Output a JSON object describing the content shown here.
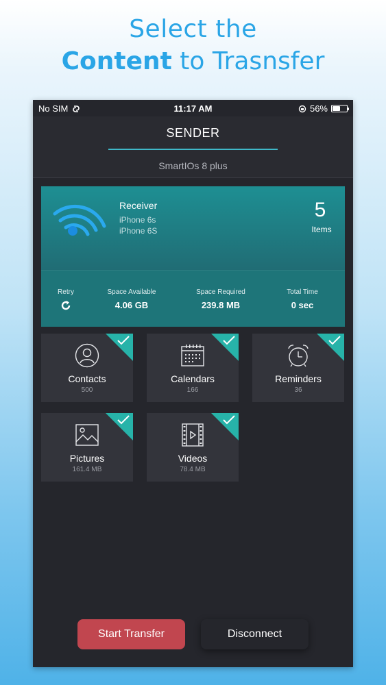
{
  "headline": {
    "line1": "Select the",
    "line2_bold": "Content",
    "line2_rest": " to Trasnsfer"
  },
  "status_bar": {
    "carrier": "No SIM",
    "time": "11:17 AM",
    "battery": "56%",
    "battery_level": 0.56
  },
  "nav": {
    "title": "SENDER",
    "device": "SmartIOs 8 plus"
  },
  "receiver": {
    "label": "Receiver",
    "line1": "iPhone 6s",
    "line2": "iPhone 6S",
    "items_count": "5",
    "items_label": "Items"
  },
  "stats": {
    "retry": "Retry",
    "space_available_label": "Space Available",
    "space_available": "4.06 GB",
    "space_required_label": "Space Required",
    "space_required": "239.8 MB",
    "total_time_label": "Total Time",
    "total_time": "0 sec"
  },
  "tiles": [
    {
      "name": "Contacts",
      "sub": "500",
      "icon": "person-icon",
      "checked": true
    },
    {
      "name": "Calendars",
      "sub": "166",
      "icon": "calendar-icon",
      "checked": true
    },
    {
      "name": "Reminders",
      "sub": "36",
      "icon": "alarm-clock-icon",
      "checked": true
    },
    {
      "name": "Pictures",
      "sub": "161.4 MB",
      "icon": "picture-icon",
      "checked": true
    },
    {
      "name": "Videos",
      "sub": "78.4 MB",
      "icon": "film-icon",
      "checked": true
    }
  ],
  "buttons": {
    "start": "Start Transfer",
    "disconnect": "Disconnect"
  },
  "colors": {
    "accent": "#2aa5e6",
    "teal": "#27b3a9",
    "start_button": "#c1464f",
    "background": "#25262c"
  }
}
